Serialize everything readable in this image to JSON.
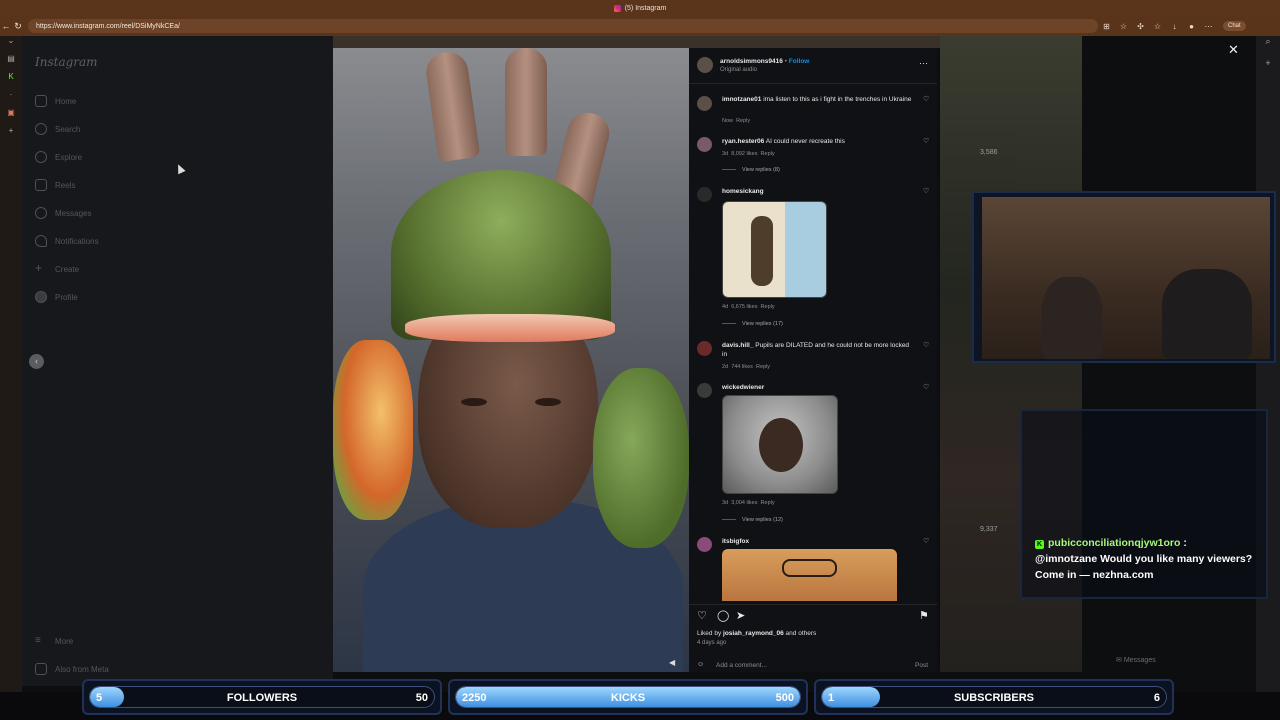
{
  "browser": {
    "tab_title": "(5) Instagram",
    "url": "https://www.instagram.com/reel/DSiMyNkCEa/",
    "chat_button": "Chat"
  },
  "instagram": {
    "logo": "Instagram",
    "nav": [
      {
        "label": "Home",
        "icon": "home-icon"
      },
      {
        "label": "Search",
        "icon": "search-icon"
      },
      {
        "label": "Explore",
        "icon": "compass-icon"
      },
      {
        "label": "Reels",
        "icon": "reels-icon"
      },
      {
        "label": "Messages",
        "icon": "messages-icon"
      },
      {
        "label": "Notifications",
        "icon": "heart-icon"
      },
      {
        "label": "Create",
        "icon": "plus-icon"
      },
      {
        "label": "Profile",
        "icon": "avatar-icon"
      }
    ],
    "more": "More",
    "also_from_meta": "Also from Meta",
    "messages_fab": "Messages"
  },
  "post": {
    "author": "arnoldsimmons9416",
    "follow": "Follow",
    "audio": "Original audio",
    "comments": [
      {
        "user": "imnotzane01",
        "text": "ima listen to this as i fight in the trenches in Ukraine",
        "time": "Now",
        "likes": "",
        "reply": "Reply",
        "view_replies": ""
      },
      {
        "user": "ryan.hester06",
        "text": "AI could never recreate this",
        "time": "3d",
        "likes": "8,092 likes",
        "reply": "Reply",
        "view_replies": "View replies (8)"
      },
      {
        "user": "homesickang",
        "text": "",
        "time": "4d",
        "likes": "6,675 likes",
        "reply": "Reply",
        "view_replies": "View replies (17)"
      },
      {
        "user": "davis.hill_",
        "text": "Pupils are DILATED and he could not be more locked in",
        "time": "2d",
        "likes": "744 likes",
        "reply": "Reply",
        "view_replies": ""
      },
      {
        "user": "wickedwiener",
        "text": "",
        "time": "3d",
        "likes": "3,004 likes",
        "reply": "Reply",
        "view_replies": "View replies (12)"
      },
      {
        "user": "itsbigfox",
        "text": "",
        "time": "",
        "likes": "",
        "reply": "",
        "view_replies": ""
      }
    ],
    "liked_by_prefix": "Liked by",
    "liked_by_user": "josiah_raymond_06",
    "liked_by_suffix": "and others",
    "posted": "4 days ago",
    "add_comment_placeholder": "Add a comment...",
    "post_button": "Post"
  },
  "stream": {
    "chat_user": "pubicconciliationqjyw1oro",
    "chat_sep": " :",
    "chat_message": "@imnotzane Would you like many viewers? Come in — nezhna.com",
    "bg_counts": [
      "3,586",
      "9,337"
    ],
    "goals": [
      {
        "label": "FOLLOWERS",
        "current": "5",
        "target": "50",
        "progress": 0.1
      },
      {
        "label": "KICKS",
        "current": "2250",
        "target": "500",
        "progress": 1.0
      },
      {
        "label": "SUBSCRIBERS",
        "current": "1",
        "target": "6",
        "progress": 0.17
      }
    ]
  },
  "colors": {
    "accent": "#0095f6",
    "kick_green": "#53fc18",
    "goal_fill": "#3f8fe0"
  }
}
